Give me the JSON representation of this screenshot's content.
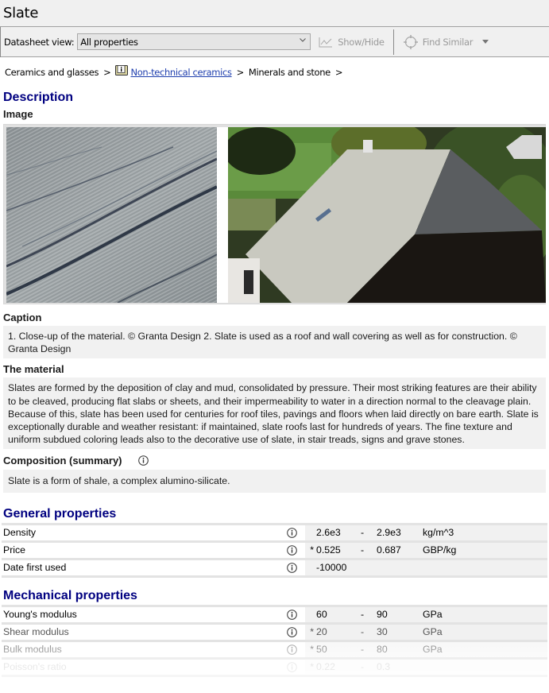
{
  "window": {
    "title": "Slate"
  },
  "toolbar": {
    "datasheet_view_label": "Datasheet view:",
    "datasheet_view_value": "All properties",
    "show_hide_label": "Show/Hide",
    "find_similar_label": "Find Similar"
  },
  "breadcrumb": {
    "items": [
      {
        "label": "Ceramics and glasses",
        "link": false
      },
      {
        "label": "Non-technical ceramics",
        "link": true,
        "icon": "book-info-icon"
      },
      {
        "label": "Minerals and stone",
        "link": false
      }
    ],
    "separator": ">"
  },
  "description": {
    "heading": "Description",
    "image_label": "Image",
    "images": [
      {
        "alt": "Close-up of slate material"
      },
      {
        "alt": "Slate roof on a building"
      }
    ],
    "caption_label": "Caption",
    "caption": "1. Close-up of the material. © Granta Design 2. Slate is used as a roof and wall covering as well as for construction. © Granta Design",
    "material_label": "The material",
    "material_text": "Slates are formed by the deposition of clay and mud, consolidated by pressure. Their most striking features are their ability to be cleaved, producing flat slabs or sheets, and their impermeability to water in a direction normal to the cleavage plain. Because of this, slate has been used for centuries for roof tiles, pavings and floors when laid directly on bare earth. Slate is exceptionally durable and weather resistant: if maintained, slate roofs last for hundreds of years. The fine texture and uniform subdued coloring leads also to the decorative use of slate, in stair treads, signs and grave stones.",
    "composition_label": "Composition (summary)",
    "composition_text": "Slate is a form of shale, a complex alumino-silicate."
  },
  "general_properties": {
    "heading": "General properties",
    "rows": [
      {
        "name": "Density",
        "estimated": "",
        "low": "2.6e3",
        "dash": "-",
        "high": "2.9e3",
        "unit": "kg/m^3"
      },
      {
        "name": "Price",
        "estimated": "*",
        "low": "0.525",
        "dash": "-",
        "high": "0.687",
        "unit": "GBP/kg"
      },
      {
        "name": "Date first used",
        "estimated": "",
        "low": "-10000",
        "dash": "",
        "high": "",
        "unit": ""
      }
    ]
  },
  "mechanical_properties": {
    "heading": "Mechanical properties",
    "rows": [
      {
        "name": "Young's modulus",
        "estimated": "",
        "low": "60",
        "dash": "-",
        "high": "90",
        "unit": "GPa"
      },
      {
        "name": "Shear modulus",
        "estimated": "*",
        "low": "20",
        "dash": "-",
        "high": "30",
        "unit": "GPa"
      },
      {
        "name": "Bulk modulus",
        "estimated": "*",
        "low": "50",
        "dash": "-",
        "high": "80",
        "unit": "GPa"
      },
      {
        "name": "Poisson's ratio",
        "estimated": "*",
        "low": "0.22",
        "dash": "-",
        "high": "0.3",
        "unit": ""
      }
    ]
  },
  "colors": {
    "section_heading": "#000080",
    "link": "#1f3fae",
    "disabled_text": "#9a9a9a",
    "panel_bg": "#f1f1f1"
  }
}
